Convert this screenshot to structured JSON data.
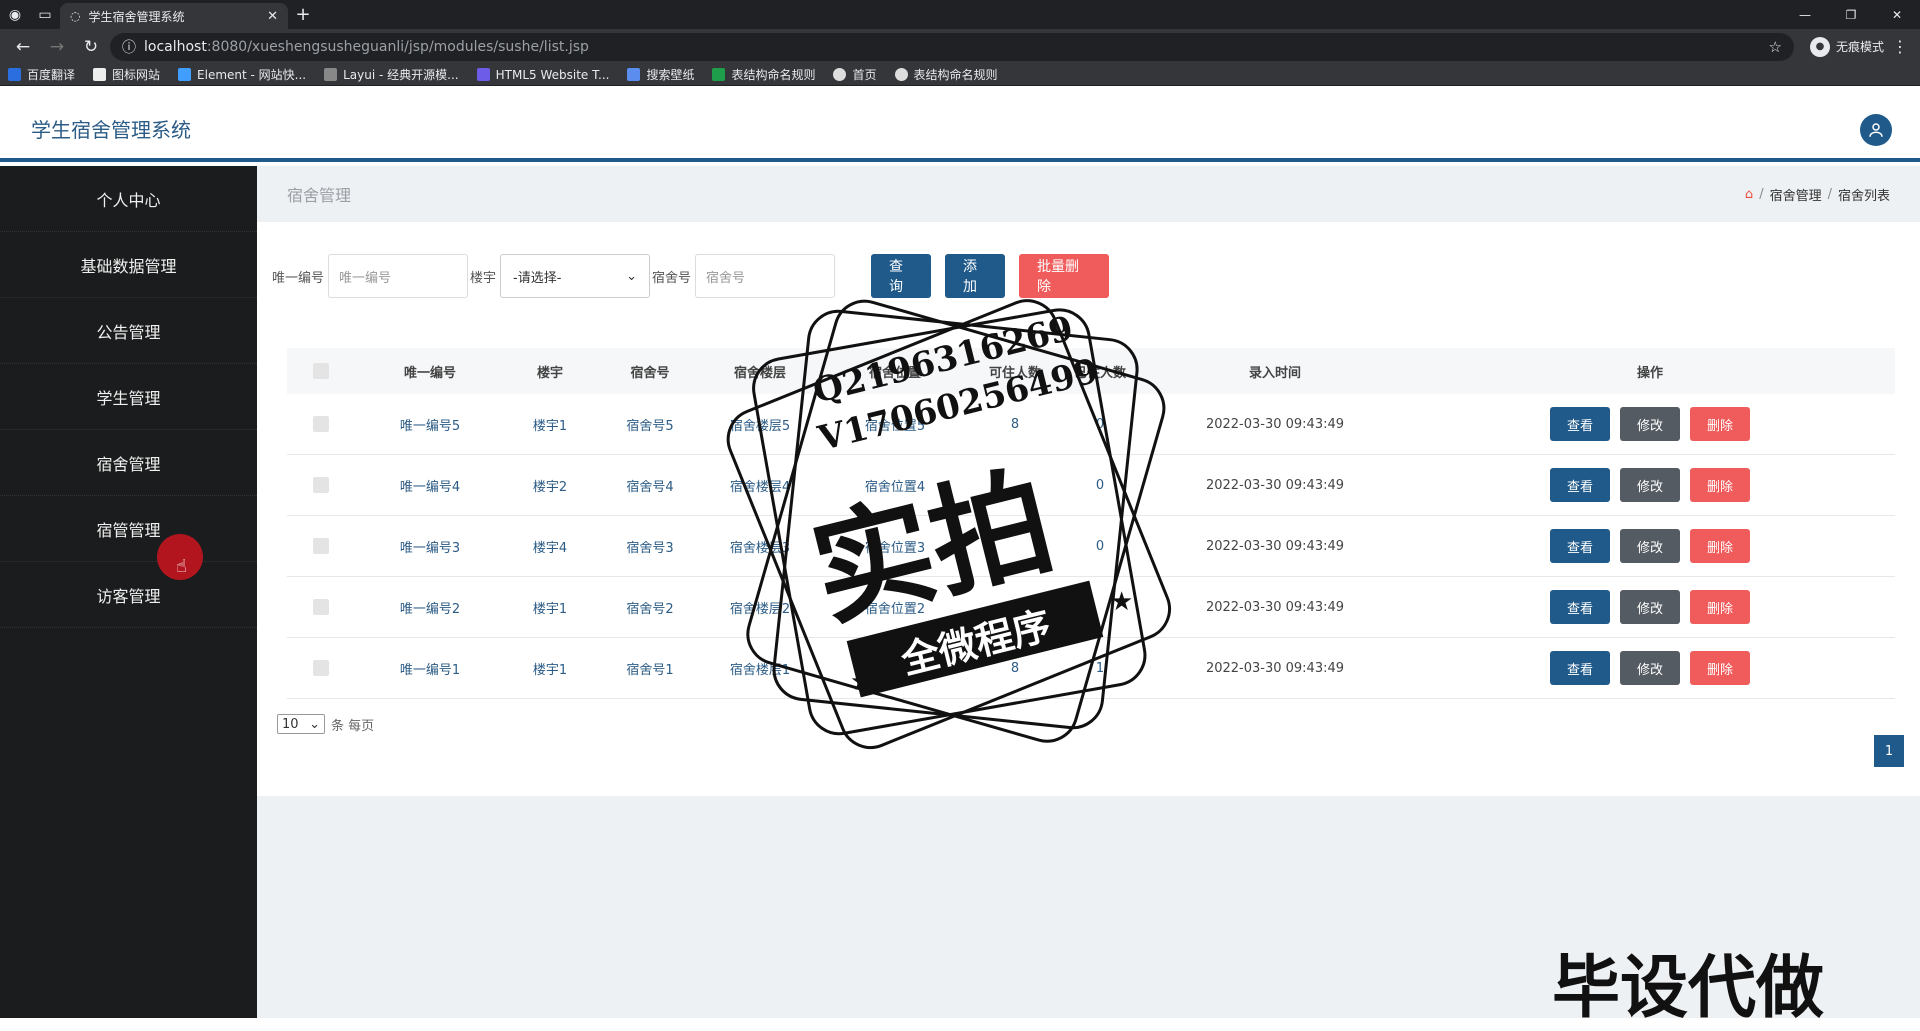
{
  "browser": {
    "tab_title": "学生宿舍管理系统",
    "url_host": "localhost",
    "url_path": ":8080/xueshengsusheguanli/jsp/modules/sushe/list.jsp",
    "incognito": "无痕模式",
    "bookmarks": [
      "百度翻译",
      "图标网站",
      "Element - 网站快...",
      "Layui - 经典开源模...",
      "HTML5 Website T...",
      "搜索壁纸",
      "表结构命名规则",
      "首页",
      "表结构命名规则"
    ]
  },
  "app": {
    "title": "学生宿舍管理系统"
  },
  "sidebar": {
    "items": [
      "个人中心",
      "基础数据管理",
      "公告管理",
      "学生管理",
      "宿舍管理",
      "宿管管理",
      "访客管理"
    ]
  },
  "page": {
    "title": "宿舍管理",
    "breadcrumb": [
      "宿舍管理",
      "宿舍列表"
    ]
  },
  "search": {
    "id_label": "唯一编号",
    "id_placeholder": "唯一编号",
    "building_label": "楼宇",
    "building_value": "-请选择-",
    "room_label": "宿舍号",
    "room_placeholder": "宿舍号",
    "query_btn": "查询",
    "add_btn": "添加",
    "batch_delete_btn": "批量删除"
  },
  "table": {
    "headers": [
      "唯一编号",
      "楼宇",
      "宿舍号",
      "宿舍楼层",
      "宿舍位置",
      "可住人数",
      "已住人数",
      "录入时间",
      "操作"
    ],
    "rows": [
      {
        "id": "唯一编号5",
        "building": "楼宇1",
        "room": "宿舍号5",
        "floor": "宿舍楼层5",
        "location": "宿舍位置5",
        "capacity": "8",
        "occupied": "0",
        "time": "2022-03-30 09:43:49"
      },
      {
        "id": "唯一编号4",
        "building": "楼宇2",
        "room": "宿舍号4",
        "floor": "宿舍楼层4",
        "location": "宿舍位置4",
        "capacity": "",
        "occupied": "0",
        "time": "2022-03-30 09:43:49"
      },
      {
        "id": "唯一编号3",
        "building": "楼宇4",
        "room": "宿舍号3",
        "floor": "宿舍楼层3",
        "location": "宿舍位置3",
        "capacity": "",
        "occupied": "0",
        "time": "2022-03-30 09:43:49"
      },
      {
        "id": "唯一编号2",
        "building": "楼宇1",
        "room": "宿舍号2",
        "floor": "宿舍楼层2",
        "location": "宿舍位置2",
        "capacity": "",
        "occupied": "",
        "time": "2022-03-30 09:43:49"
      },
      {
        "id": "唯一编号1",
        "building": "楼宇1",
        "room": "宿舍号1",
        "floor": "宿舍楼层1",
        "location": "宿舍位置1",
        "capacity": "8",
        "occupied": "1",
        "time": "2022-03-30 09:43:49"
      }
    ],
    "actions": {
      "view": "查看",
      "edit": "修改",
      "delete": "删除"
    }
  },
  "pagination": {
    "page_size": "10",
    "per_page_label": "条 每页",
    "current_page": "1"
  },
  "watermark": {
    "contact_q": "Q2196316269",
    "contact_v": "V17060256499",
    "big": "实拍",
    "banner": "全微程序",
    "corner": "毕设代做"
  },
  "colors": {
    "primary": "#1f5a8a",
    "danger": "#f05b5b",
    "sidebar_bg": "#1b1c1d"
  }
}
